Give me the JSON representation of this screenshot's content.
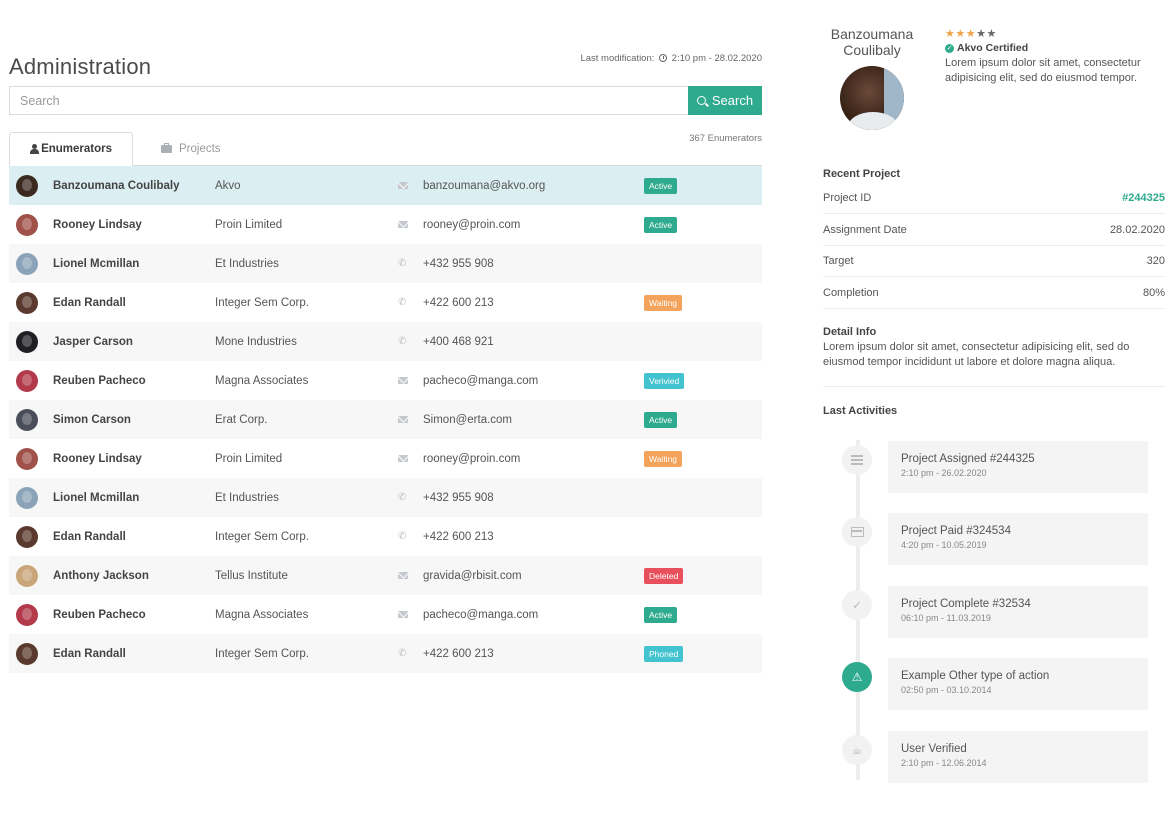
{
  "page": {
    "title": "Administration",
    "last_modification_label": "Last modification:",
    "last_modification_value": "2:10 pm - 28.02.2020"
  },
  "search": {
    "placeholder": "Search",
    "button_label": "Search"
  },
  "tabs": [
    {
      "label": "Enumerators",
      "icon": "user-icon",
      "active": true
    },
    {
      "label": "Projects",
      "icon": "briefcase-icon",
      "active": false
    }
  ],
  "count_label": "367 Enumerators",
  "status_colors": {
    "Active": "#2eaa8e",
    "Waiting": "#f3a35b",
    "Verivied": "#43c2cf",
    "Deleted": "#e8505b",
    "Phoned": "#43c2cf"
  },
  "rows": [
    {
      "name": "Banzoumana Coulibaly",
      "org": "Akvo",
      "contact_type": "email",
      "contact": "banzoumana@akvo.org",
      "status": "Active",
      "avatar": "#3a2a20",
      "selected": true
    },
    {
      "name": "Rooney Lindsay",
      "org": "Proin Limited",
      "contact_type": "email",
      "contact": "rooney@proin.com",
      "status": "Active",
      "avatar": "#a0524a"
    },
    {
      "name": "Lionel Mcmillan",
      "org": "Et Industries",
      "contact_type": "phone",
      "contact": "+432 955 908",
      "status": "",
      "avatar": "#8aa3b8"
    },
    {
      "name": "Edan Randall",
      "org": "Integer Sem Corp.",
      "contact_type": "phone",
      "contact": "+422 600 213",
      "status": "Waiting",
      "avatar": "#5a3a2e"
    },
    {
      "name": "Jasper Carson",
      "org": "Mone Industries",
      "contact_type": "phone",
      "contact": "+400 468 921",
      "status": "",
      "avatar": "#1f1f24"
    },
    {
      "name": "Reuben Pacheco",
      "org": "Magna Associates",
      "contact_type": "email",
      "contact": "pacheco@manga.com",
      "status": "Verivied",
      "avatar": "#b23a4a"
    },
    {
      "name": "Simon Carson",
      "org": "Erat Corp.",
      "contact_type": "email",
      "contact": "Simon@erta.com",
      "status": "Active",
      "avatar": "#4a4e5a"
    },
    {
      "name": "Rooney Lindsay",
      "org": "Proin Limited",
      "contact_type": "email",
      "contact": "rooney@proin.com",
      "status": "Waiting",
      "avatar": "#a0524a"
    },
    {
      "name": "Lionel Mcmillan",
      "org": "Et Industries",
      "contact_type": "phone",
      "contact": "+432 955 908",
      "status": "",
      "avatar": "#8aa3b8"
    },
    {
      "name": "Edan Randall",
      "org": "Integer Sem Corp.",
      "contact_type": "phone",
      "contact": "+422 600 213",
      "status": "",
      "avatar": "#5a3a2e"
    },
    {
      "name": "Anthony Jackson",
      "org": "Tellus Institute",
      "contact_type": "email",
      "contact": "gravida@rbisit.com",
      "status": "Deleted",
      "avatar": "#c9a57a"
    },
    {
      "name": "Reuben Pacheco",
      "org": "Magna Associates",
      "contact_type": "email",
      "contact": "pacheco@manga.com",
      "status": "Active",
      "avatar": "#b23a4a"
    },
    {
      "name": "Edan Randall",
      "org": "Integer Sem Corp.",
      "contact_type": "phone",
      "contact": "+422 600 213",
      "status": "Phoned",
      "avatar": "#5a3a2e"
    }
  ],
  "profile": {
    "first_name": "Banzoumana",
    "last_name": "Coulibaly",
    "rating": 3,
    "rating_max": 5,
    "certified_label": "Akvo Certified",
    "bio": "Lorem ipsum dolor sit amet, consectetur adipisicing elit, sed do eiusmod tempor."
  },
  "recent_project": {
    "title": "Recent Project",
    "fields": [
      {
        "label": "Project ID",
        "value": "#244325",
        "link": true
      },
      {
        "label": "Assignment Date",
        "value": "28.02.2020"
      },
      {
        "label": "Target",
        "value": "320"
      },
      {
        "label": "Completion",
        "value": "80%"
      }
    ]
  },
  "detail_info": {
    "title": "Detail Info",
    "text": "Lorem ipsum dolor sit amet, consectetur adipisicing elit, sed do eiusmod tempor incididunt ut labore et dolore magna aliqua."
  },
  "last_activities": {
    "title": "Last Activities",
    "items": [
      {
        "title": "Project Assigned #244325",
        "time": "2:10 pm - 26.02.2020",
        "icon": "list-icon"
      },
      {
        "title": "Project Paid #324534",
        "time": "4:20 pm - 10.05.2019",
        "icon": "credit-card-icon"
      },
      {
        "title": "Project Complete #32534",
        "time": "06:10 pm - 11.03.2019",
        "icon": "check-icon"
      },
      {
        "title": "Example Other type of action",
        "time": "02:50 pm - 03.10.2014",
        "icon": "warning-icon"
      },
      {
        "title": "User Verified",
        "time": "2:10 pm - 12.06.2014",
        "icon": "coffee-icon"
      }
    ]
  }
}
